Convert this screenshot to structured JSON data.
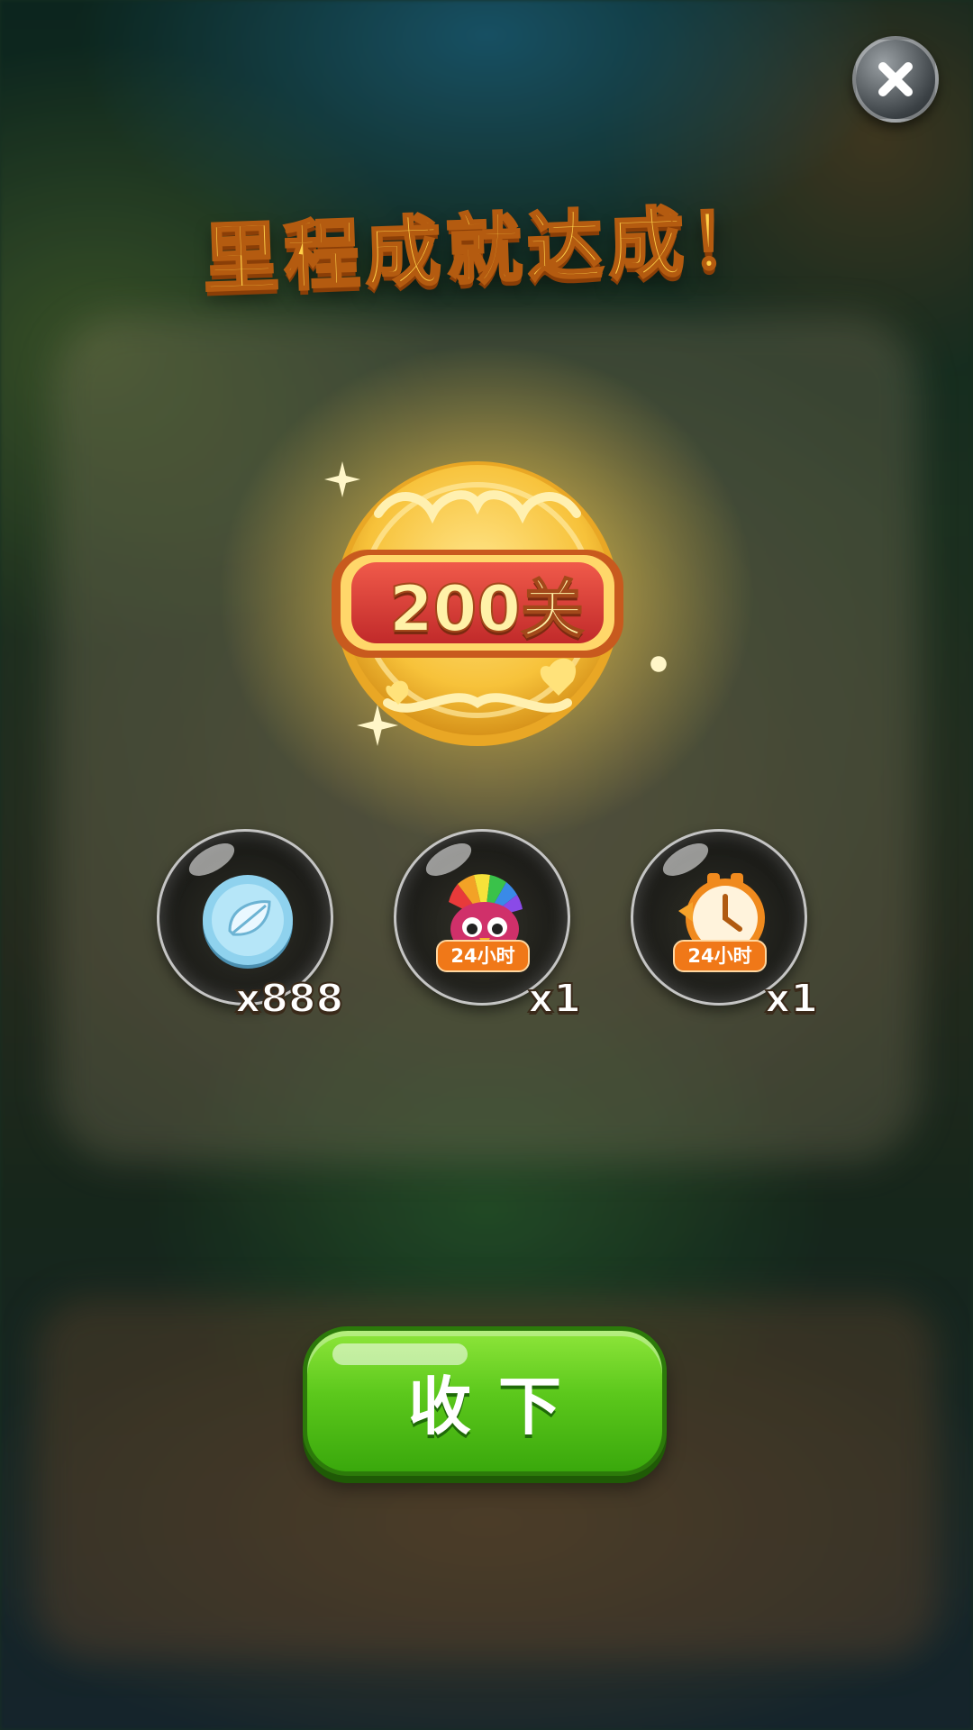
{
  "dialog": {
    "title": "里程成就达成！",
    "medal_label": "200关"
  },
  "rewards": [
    {
      "icon": "silver-leaf-coin-icon",
      "duration": "",
      "quantity": "x888"
    },
    {
      "icon": "rainbow-bird-booster-icon",
      "duration": "24小时",
      "quantity": "x1"
    },
    {
      "icon": "clock-time-booster-icon",
      "duration": "24小时",
      "quantity": "x1"
    }
  ],
  "collect_button": {
    "label": "收下"
  },
  "colors": {
    "title": "#ffd24a",
    "button_green": "#5cc81c",
    "badge_orange": "#f07818",
    "medal_gold": "#f7c23a",
    "medal_red": "#d83a3a"
  }
}
